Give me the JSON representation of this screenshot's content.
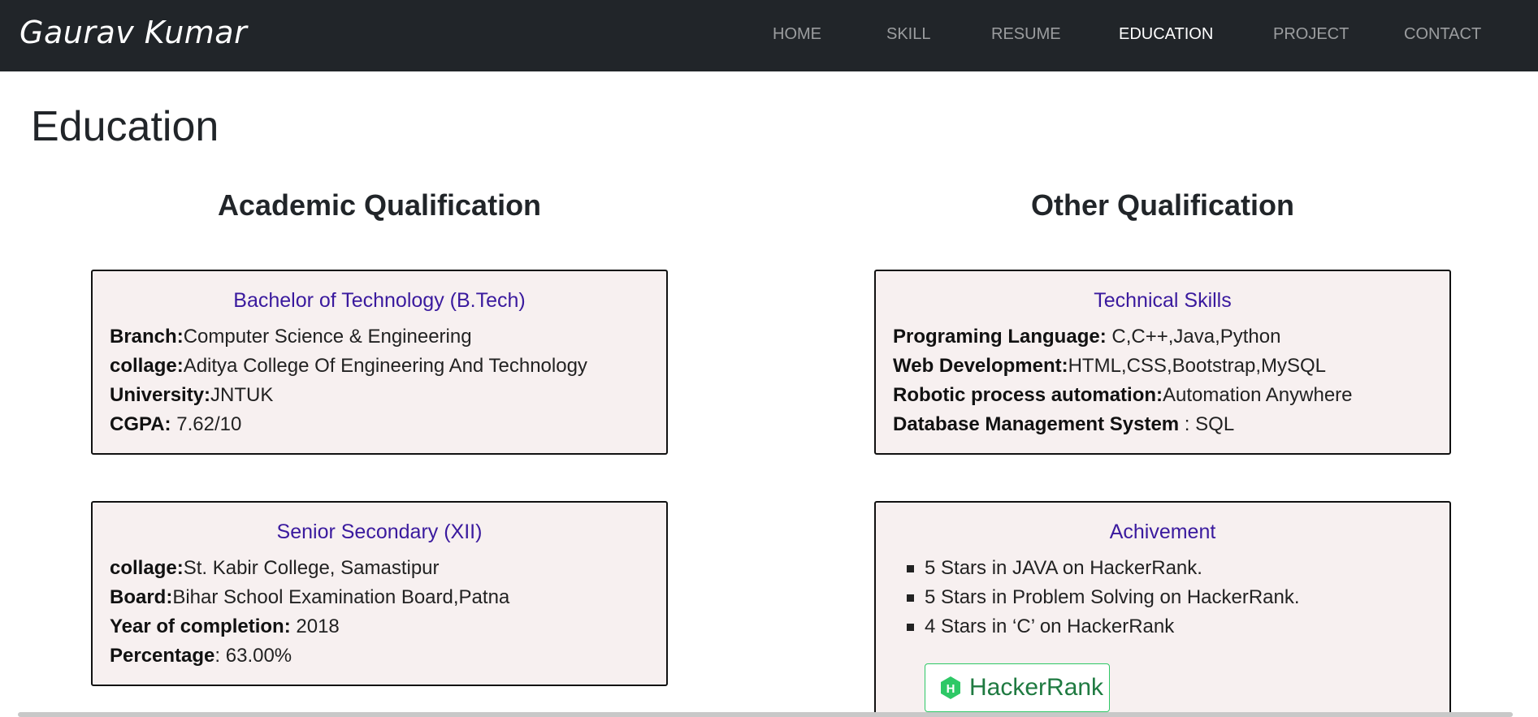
{
  "navbar": {
    "brand": "Gaurav Kumar",
    "links": [
      {
        "label": "HOME"
      },
      {
        "label": "SKILL"
      },
      {
        "label": "RESUME"
      },
      {
        "label": "EDUCATION"
      },
      {
        "label": "PROJECT"
      },
      {
        "label": "CONTACT"
      }
    ],
    "active": "EDUCATION"
  },
  "page": {
    "title": "Education"
  },
  "academic": {
    "heading": "Academic Qualification",
    "btech": {
      "title": "Bachelor of Technology (B.Tech)",
      "branch_label": "Branch:",
      "branch_value": "Computer Science & Engineering",
      "college_label": "collage:",
      "college_value": "Aditya College Of Engineering And Technology",
      "university_label": "University:",
      "university_value": "JNTUK",
      "cgpa_label": "CGPA:",
      "cgpa_value": " 7.62/10"
    },
    "senior": {
      "title": "Senior Secondary (XII)",
      "college_label": "collage:",
      "college_value": "St. Kabir College, Samastipur",
      "board_label": "Board:",
      "board_value": "Bihar School Examination Board,Patna",
      "year_label": "Year of completion:",
      "year_value": " 2018",
      "percentage_label": "Percentage",
      "percentage_value": ": 63.00%"
    }
  },
  "other": {
    "heading": "Other Qualification",
    "skills": {
      "title": "Technical Skills",
      "lang_label": "Programing Language:",
      "lang_value": " C,C++,Java,Python",
      "web_label": "Web Development:",
      "web_value": "HTML,CSS,Bootstrap,MySQL",
      "rpa_label": "Robotic process automation:",
      "rpa_value": "Automation Anywhere",
      "dbms_label": "Database Management System",
      "dbms_value": " : SQL"
    },
    "achievement": {
      "title": "Achivement",
      "items": [
        "5 Stars in JAVA on HackerRank.",
        "5 Stars in Problem Solving on HackerRank.",
        "4 Stars in ‘C’ on HackerRank"
      ],
      "badge_text": "HackerRank",
      "badge_color": "#2ec866"
    }
  },
  "colors": {
    "navbar_bg": "#212529",
    "card_bg": "#f7f0f0",
    "card_title": "#3a1a9e"
  }
}
